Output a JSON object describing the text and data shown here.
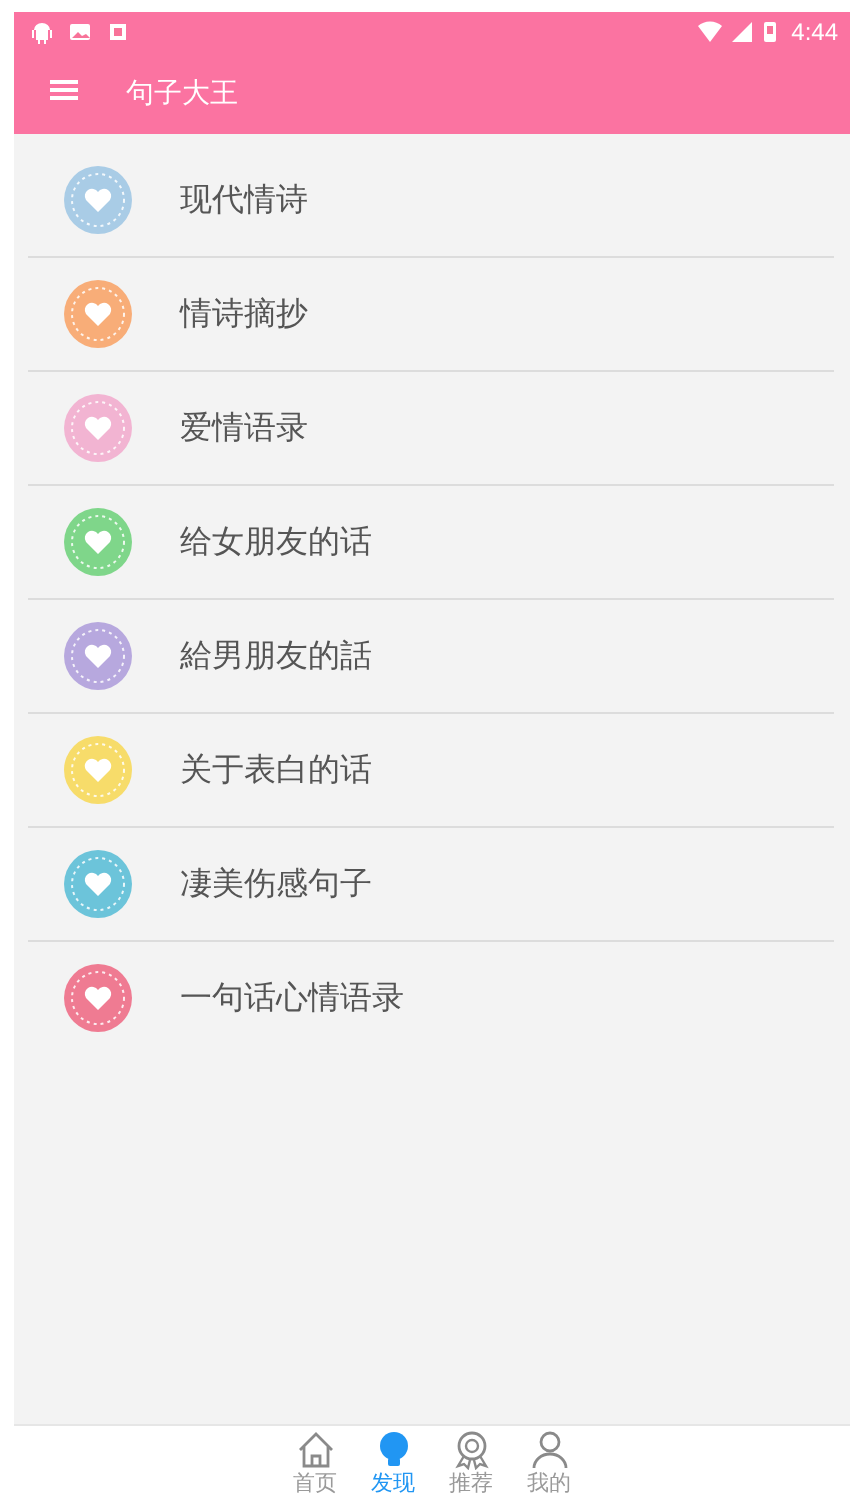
{
  "status_bar": {
    "time": "4:44"
  },
  "app_bar": {
    "title": "句子大王"
  },
  "items": [
    {
      "label": "现代情诗",
      "color": "#a9cce6"
    },
    {
      "label": "情诗摘抄",
      "color": "#f8ad78"
    },
    {
      "label": "爱情语录",
      "color": "#f2b4d2"
    },
    {
      "label": "给女朋友的话",
      "color": "#7fd68a"
    },
    {
      "label": "給男朋友的話",
      "color": "#b7a8de"
    },
    {
      "label": "关于表白的话",
      "color": "#f7dc6a"
    },
    {
      "label": "凄美伤感句子",
      "color": "#6cc4da"
    },
    {
      "label": "一句话心情语录",
      "color": "#ef7b92"
    }
  ],
  "tabs": [
    {
      "label": "首页",
      "selected": false
    },
    {
      "label": "发现",
      "selected": true
    },
    {
      "label": "推荐",
      "selected": false
    },
    {
      "label": "我的",
      "selected": false
    }
  ]
}
